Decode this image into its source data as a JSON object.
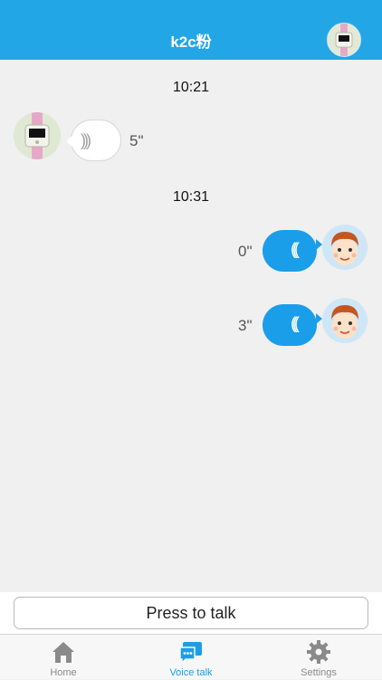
{
  "header": {
    "title": "k2c粉"
  },
  "messages": [
    {
      "time": "10:21"
    },
    {
      "incoming_duration": "5\""
    },
    {
      "time": "10:31"
    },
    {
      "outgoing_duration_1": "0\""
    },
    {
      "outgoing_duration_2": "3\""
    }
  ],
  "chat": {
    "time_1": "10:21",
    "time_2": "10:31",
    "incoming": {
      "duration": "5\"",
      "wave": ")))"
    },
    "outgoing": [
      {
        "duration": "0\"",
        "wave": "((("
      },
      {
        "duration": "3\"",
        "wave": "((("
      }
    ]
  },
  "talk": {
    "button_label": "Press to talk"
  },
  "tabs": [
    {
      "label": "Home",
      "icon": "home-icon"
    },
    {
      "label": "Voice talk",
      "icon": "chat-icon",
      "active": true
    },
    {
      "label": "Settings",
      "icon": "gear-icon"
    }
  ],
  "colors": {
    "accent": "#23a6e6",
    "bubble_out": "#1b9ee9"
  }
}
